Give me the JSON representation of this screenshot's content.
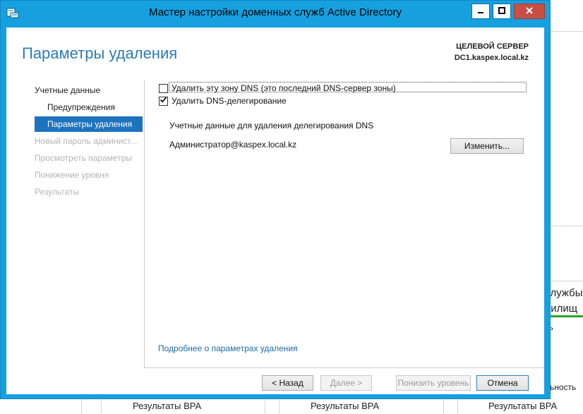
{
  "window": {
    "title": "Мастер настройки доменных служб Active Directory",
    "icons": {
      "app": "wizard-app-icon",
      "minimize": "minimize-icon",
      "maximize": "maximize-icon",
      "close": "close-icon"
    }
  },
  "header": {
    "page_title": "Параметры удаления",
    "target_label": "ЦЕЛЕВОЙ СЕРВЕР",
    "target_server": "DC1.kaspex.local.kz"
  },
  "nav": {
    "items": [
      {
        "label": "Учетные данные",
        "state": "enabled"
      },
      {
        "label": "Предупреждения",
        "state": "enabled"
      },
      {
        "label": "Параметры удаления",
        "state": "selected"
      },
      {
        "label": "Новый пароль админист...",
        "state": "disabled"
      },
      {
        "label": "Просмотреть параметры",
        "state": "disabled"
      },
      {
        "label": "Понижение уровня",
        "state": "disabled"
      },
      {
        "label": "Результаты",
        "state": "disabled"
      }
    ]
  },
  "options": {
    "remove_zone": {
      "label": "Удалить эту зону DNS (это последний DNS-сервер зоны)",
      "checked": false
    },
    "remove_delegation": {
      "label": "Удалить DNS-делегирование",
      "checked": true
    }
  },
  "credentials": {
    "title": "Учетные данные для удаления делегирования DNS",
    "user": "Администратор@kaspex.local.kz",
    "change_button": "Изменить..."
  },
  "more_link": "Подробнее о параметрах удаления",
  "buttons": {
    "back": "< Назад",
    "next": "Далее >",
    "demote": "Понизить уровень",
    "cancel": "Отмена"
  },
  "background": {
    "partial_1": "службы",
    "partial_2": "нилищ",
    "partial_3": "ть",
    "partial_4": "льность",
    "bpa": [
      "Результаты BPA",
      "Результаты BPA",
      "Результаты BPA"
    ]
  },
  "colors": {
    "window_frame": "#16a0e0",
    "title_accent": "#2b7bb9",
    "nav_selected": "#1e73be",
    "close_button": "#c74f44",
    "link": "#1b6ba8"
  }
}
